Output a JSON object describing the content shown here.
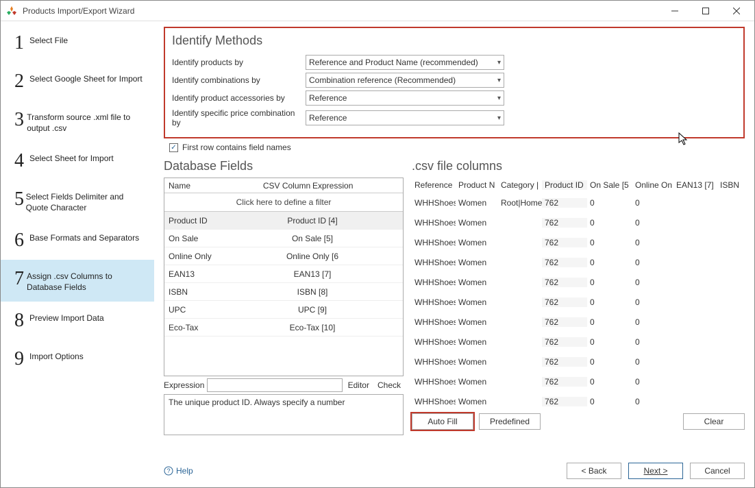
{
  "window": {
    "title": "Products Import/Export Wizard"
  },
  "steps": [
    {
      "num": "1",
      "label": "Select File"
    },
    {
      "num": "2",
      "label": "Select Google Sheet for Import"
    },
    {
      "num": "3",
      "label": "Transform source .xml file to output .csv"
    },
    {
      "num": "4",
      "label": "Select Sheet for Import"
    },
    {
      "num": "5",
      "label": "Select Fields Delimiter and Quote Character"
    },
    {
      "num": "6",
      "label": "Base Formats and Separators"
    },
    {
      "num": "7",
      "label": "Assign .csv Columns to Database Fields"
    },
    {
      "num": "8",
      "label": "Preview Import Data"
    },
    {
      "num": "9",
      "label": "Import Options"
    }
  ],
  "identify": {
    "heading": "Identify Methods",
    "rows": [
      {
        "label": "Identify products by",
        "value": "Reference and Product Name (recommended)"
      },
      {
        "label": "Identify combinations by",
        "value": "Combination reference (Recommended)"
      },
      {
        "label": "Identify product accessories by",
        "value": "Reference"
      },
      {
        "label": "Identify specific price combination by",
        "value": "Reference"
      }
    ]
  },
  "checkbox": {
    "checked": "✓",
    "label": "First row contains field names"
  },
  "db": {
    "heading": "Database Fields",
    "headers": {
      "name": "Name",
      "csv": "CSV Column",
      "expr": "Expression"
    },
    "filter": "Click here to define a filter",
    "rows": [
      {
        "name": "Product ID",
        "csv": "Product ID [4]",
        "sel": true
      },
      {
        "name": "On Sale",
        "csv": "On Sale [5]"
      },
      {
        "name": "Online Only",
        "csv": "Online Only [6"
      },
      {
        "name": "EAN13",
        "csv": "EAN13 [7]"
      },
      {
        "name": "ISBN",
        "csv": "ISBN [8]"
      },
      {
        "name": "UPC",
        "csv": "UPC [9]"
      },
      {
        "name": "Eco-Tax",
        "csv": "Eco-Tax [10]"
      }
    ],
    "expr_label": "Expression",
    "expr_value": "",
    "editor_btn": "Editor",
    "check_btn": "Check",
    "help_text": "The unique product ID. Always specify a number"
  },
  "csv": {
    "heading": ".csv file columns",
    "headers": {
      "ref": "Reference",
      "pn": "Product N",
      "cat": "Category |",
      "pid": "Product ID",
      "os": "On Sale [5",
      "oo": "Online On",
      "ean": "EAN13 [7]",
      "isbn": "ISBN"
    },
    "rows": [
      {
        "ref": "WHHShoes",
        "pn": "Women",
        "cat": "Root|Home",
        "pid": "762",
        "os": "0",
        "oo": "0",
        "ean": "",
        "isbn": ""
      },
      {
        "ref": "WHHShoes",
        "pn": "Women",
        "cat": "",
        "pid": "762",
        "os": "0",
        "oo": "0",
        "ean": "",
        "isbn": ""
      },
      {
        "ref": "WHHShoes",
        "pn": "Women",
        "cat": "",
        "pid": "762",
        "os": "0",
        "oo": "0",
        "ean": "",
        "isbn": ""
      },
      {
        "ref": "WHHShoes",
        "pn": "Women",
        "cat": "",
        "pid": "762",
        "os": "0",
        "oo": "0",
        "ean": "",
        "isbn": ""
      },
      {
        "ref": "WHHShoes",
        "pn": "Women",
        "cat": "",
        "pid": "762",
        "os": "0",
        "oo": "0",
        "ean": "",
        "isbn": ""
      },
      {
        "ref": "WHHShoes",
        "pn": "Women",
        "cat": "",
        "pid": "762",
        "os": "0",
        "oo": "0",
        "ean": "",
        "isbn": ""
      },
      {
        "ref": "WHHShoes",
        "pn": "Women",
        "cat": "",
        "pid": "762",
        "os": "0",
        "oo": "0",
        "ean": "",
        "isbn": ""
      },
      {
        "ref": "WHHShoes",
        "pn": "Women",
        "cat": "",
        "pid": "762",
        "os": "0",
        "oo": "0",
        "ean": "",
        "isbn": ""
      },
      {
        "ref": "WHHShoes",
        "pn": "Women",
        "cat": "",
        "pid": "762",
        "os": "0",
        "oo": "0",
        "ean": "",
        "isbn": ""
      },
      {
        "ref": "WHHShoes",
        "pn": "Women",
        "cat": "",
        "pid": "762",
        "os": "0",
        "oo": "0",
        "ean": "",
        "isbn": ""
      },
      {
        "ref": "WHHShoes",
        "pn": "Women",
        "cat": "",
        "pid": "762",
        "os": "0",
        "oo": "0",
        "ean": "",
        "isbn": ""
      }
    ]
  },
  "buttons": {
    "autofill": "Auto Fill",
    "predefined": "Predefined",
    "clear": "Clear"
  },
  "footer": {
    "help": "Help",
    "back": "< Back",
    "next": "Next >",
    "cancel": "Cancel"
  }
}
